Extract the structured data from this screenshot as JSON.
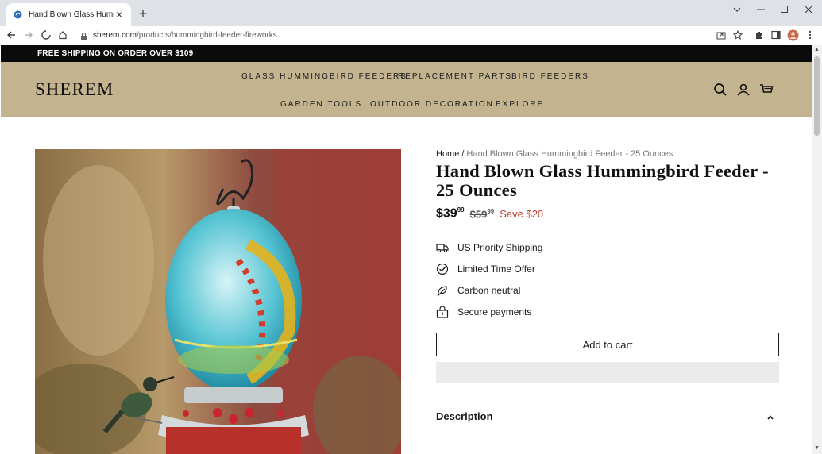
{
  "browser": {
    "tab_title": "Hand Blown Glass Hummingbird",
    "url_host": "sherem.com",
    "url_path": "/products/hummingbird-feeder-fireworks"
  },
  "announcement": "FREE SHIPPING ON ORDER OVER $109",
  "brand": "SHEREM",
  "nav": {
    "row1": [
      "GLASS HUMMINGBIRD FEEDERS",
      "REPLACEMENT PARTS",
      "BIRD FEEDERS"
    ],
    "row2": [
      "GARDEN TOOLS",
      "OUTDOOR DECORATION",
      "EXPLORE"
    ]
  },
  "breadcrumb": {
    "home": "Home",
    "sep": "/",
    "current": "Hand Blown Glass Hummingbird Feeder - 25 Ounces"
  },
  "product": {
    "title": "Hand Blown Glass Hummingbird Feeder - 25 Ounces",
    "price_main": "$39",
    "price_cents": "99",
    "old_main": "$59",
    "old_cents": "99",
    "save": "Save $20"
  },
  "features": [
    {
      "icon": "truck-icon",
      "label": "US Priority Shipping"
    },
    {
      "icon": "check-circle-icon",
      "label": "Limited Time Offer"
    },
    {
      "icon": "leaf-icon",
      "label": "Carbon neutral"
    },
    {
      "icon": "lock-icon",
      "label": "Secure payments"
    }
  ],
  "add_to_cart": "Add to cart",
  "description_label": "Description",
  "colors": {
    "header_bg": "#c3b38f",
    "save_red": "#c0392b",
    "announce_bg": "#0b0b0b"
  }
}
